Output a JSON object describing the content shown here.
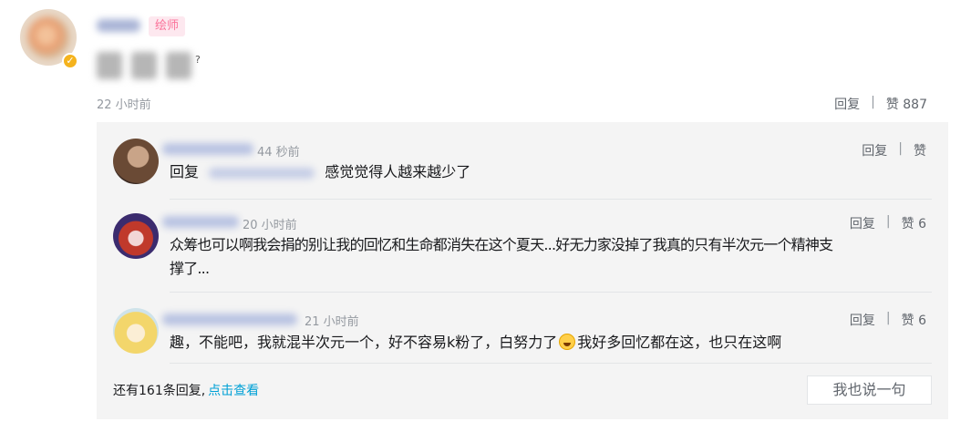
{
  "main_comment": {
    "role_badge": "绘师",
    "time": "22 小时前",
    "reply_label": "回复",
    "like_label": "赞",
    "like_count": "887",
    "separator": "|"
  },
  "replies": [
    {
      "time": "44 秒前",
      "reply_label": "回复",
      "like_label": "赞",
      "like_count": "",
      "text_prefix": "回复",
      "text": "感觉觉得人越来越少了"
    },
    {
      "time": "20 小时前",
      "reply_label": "回复",
      "like_label": "赞",
      "like_count": "6",
      "text_line1": "众筹也可以啊我会捐的别让我的回忆和生命都消失在这个夏天...好无力家没掉了我真的只有半次元一个精神支",
      "text_line2": "撑了..."
    },
    {
      "time": "21 小时前",
      "reply_label": "回复",
      "like_label": "赞",
      "like_count": "6",
      "text_before": "趣，不能吧，我就混半次元一个，好不容易k粉了，白努力了",
      "text_after": "我好多回忆都在这，也只在这啊"
    }
  ],
  "footer": {
    "more_text": "还有161条回复,",
    "more_link": "点击查看",
    "say_button": "我也说一句"
  },
  "icons": {
    "verify": "verify-badge-icon",
    "emoji": "crying-emoji-icon"
  },
  "colors": {
    "badge_pink": "#fb7299",
    "link_blue": "#00a1d6",
    "reply_bg": "#f4f4f4"
  }
}
